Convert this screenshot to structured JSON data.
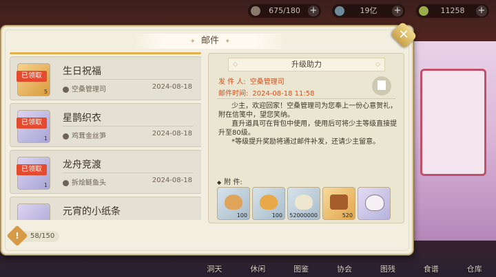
{
  "topbar": {
    "stamina": "675/180",
    "coins": "19亿",
    "gems": "11258"
  },
  "bottomnav": [
    "洞天",
    "休闲",
    "图鉴",
    "协会",
    "图残",
    "食谱",
    "仓库"
  ],
  "panel": {
    "title": "邮件",
    "close_label": "✕"
  },
  "mails": [
    {
      "title": "生日祝福",
      "sender": "空桑管理司",
      "date": "2024-08-18",
      "tag": "已领取",
      "count": "5"
    },
    {
      "title": "星鹊织衣",
      "sender": "鸡茸金丝笋",
      "date": "2024-08-18",
      "tag": "已领取",
      "count": "1"
    },
    {
      "title": "龙舟竞渡",
      "sender": "拆烩鲢鱼头",
      "date": "2024-08-18",
      "tag": "已领取",
      "count": "1"
    },
    {
      "title": "元宵的小纸条",
      "sender": "",
      "date": "",
      "tag": "",
      "count": ""
    }
  ],
  "counter": {
    "icon": "!",
    "value": "58/150"
  },
  "detail": {
    "title": "升级助力",
    "sender_label": "发 件 人:",
    "sender": "空桑管理司",
    "time_label": "邮件时间:",
    "time": "2024-08-18  11:58",
    "body": "      少主，欢迎回家！空桑管理司为您奉上一份心意贺礼，附在信笺中，望您笑纳。\n      直升道具可在背包中使用，使用后可将少主等级直接提升至80级。\n      *等级提升奖励将通过邮件补发，还请少主留意。",
    "attach_label": "附      件:",
    "attachments": [
      {
        "name": "cashew-item",
        "count": "100"
      },
      {
        "name": "pastry-item",
        "count": "100"
      },
      {
        "name": "dumpling-item",
        "count": "52000000"
      },
      {
        "name": "treasure-chest-item",
        "count": "520"
      },
      {
        "name": "cat-portrait-item",
        "count": ""
      }
    ]
  }
}
